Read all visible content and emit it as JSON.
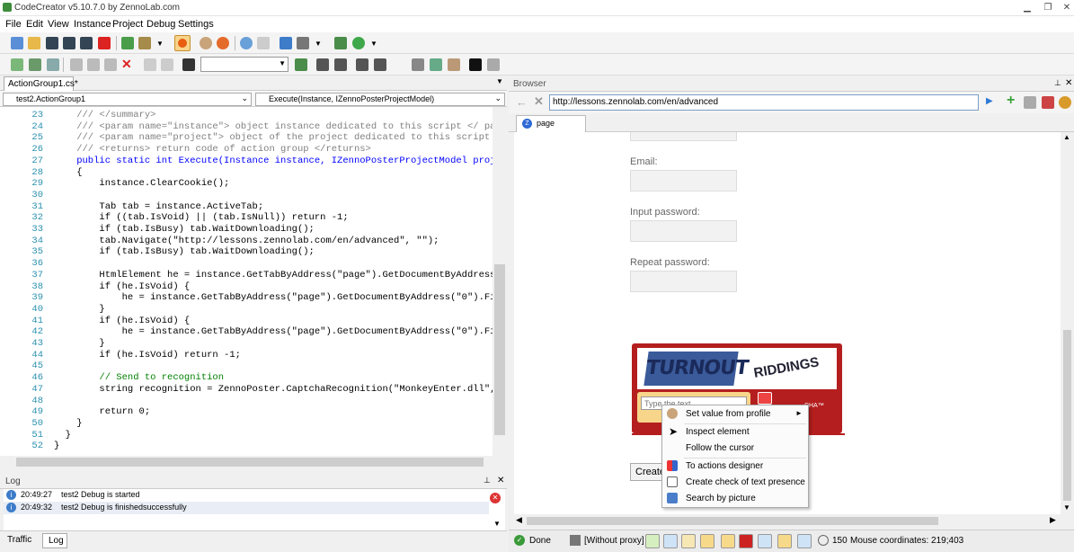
{
  "window": {
    "title": "CodeCreator v5.10.7.0 by ZennoLab.com"
  },
  "menu": [
    "File",
    "Edit",
    "View",
    "Instance",
    "Project",
    "Debug",
    "Settings"
  ],
  "editor": {
    "tab": "ActionGroup1.cs*",
    "class_combo": "test2.ActionGroup1",
    "method_combo": "Execute(Instance, IZennoPosterProjectModel)",
    "lines": [
      {
        "n": "23",
        "t": "    /// </summary>",
        "c": "xml"
      },
      {
        "n": "24",
        "t": "    /// <param name=\"instance\"> object instance dedicated to this script </ pa",
        "c": "xml"
      },
      {
        "n": "25",
        "t": "    /// <param name=\"project\"> object of the project dedicated to this script",
        "c": "xml"
      },
      {
        "n": "26",
        "t": "    /// <returns> return code of action group </returns>",
        "c": "xml"
      },
      {
        "n": "27",
        "t": "    public static int Execute(Instance instance, IZennoPosterProjectModel proj",
        "c": "kwline"
      },
      {
        "n": "28",
        "t": "    {",
        "c": ""
      },
      {
        "n": "29",
        "t": "        instance.ClearCookie();",
        "c": ""
      },
      {
        "n": "30",
        "t": "",
        "c": ""
      },
      {
        "n": "31",
        "t": "        Tab tab = instance.ActiveTab;",
        "c": ""
      },
      {
        "n": "32",
        "t": "        if ((tab.IsVoid) || (tab.IsNull)) return -1;",
        "c": ""
      },
      {
        "n": "33",
        "t": "        if (tab.IsBusy) tab.WaitDownloading();",
        "c": ""
      },
      {
        "n": "34",
        "t": "        tab.Navigate(\"http://lessons.zennolab.com/en/advanced\", \"\");",
        "c": ""
      },
      {
        "n": "35",
        "t": "        if (tab.IsBusy) tab.WaitDownloading();",
        "c": ""
      },
      {
        "n": "36",
        "t": "",
        "c": ""
      },
      {
        "n": "37",
        "t": "        HtmlElement he = instance.GetTabByAddress(\"page\").GetDocumentByAddress",
        "c": ""
      },
      {
        "n": "38",
        "t": "        if (he.IsVoid) {",
        "c": ""
      },
      {
        "n": "39",
        "t": "            he = instance.GetTabByAddress(\"page\").GetDocumentByAddress(\"0\").Fi",
        "c": ""
      },
      {
        "n": "40",
        "t": "        }",
        "c": ""
      },
      {
        "n": "41",
        "t": "        if (he.IsVoid) {",
        "c": ""
      },
      {
        "n": "42",
        "t": "            he = instance.GetTabByAddress(\"page\").GetDocumentByAddress(\"0\").Fi",
        "c": ""
      },
      {
        "n": "43",
        "t": "        }",
        "c": ""
      },
      {
        "n": "44",
        "t": "        if (he.IsVoid) return -1;",
        "c": ""
      },
      {
        "n": "45",
        "t": "",
        "c": ""
      },
      {
        "n": "46",
        "t": "        // Send to recognition",
        "c": "cm"
      },
      {
        "n": "47",
        "t": "        string recognition = ZennoPoster.CaptchaRecognition(\"MonkeyEnter.dll\",",
        "c": ""
      },
      {
        "n": "48",
        "t": "",
        "c": ""
      },
      {
        "n": "49",
        "t": "        return 0;",
        "c": ""
      },
      {
        "n": "50",
        "t": "    }",
        "c": ""
      },
      {
        "n": "51",
        "t": "  }",
        "c": ""
      },
      {
        "n": "52",
        "t": "}",
        "c": ""
      }
    ]
  },
  "log": {
    "title": "Log",
    "entries": [
      {
        "time": "20:49:27",
        "msg": "test2 Debug is started"
      },
      {
        "time": "20:49:32",
        "msg": "test2 Debug is finishedsuccessfully"
      }
    ],
    "tabs": [
      "Traffic",
      "Log"
    ]
  },
  "browser": {
    "title": "Browser",
    "url": "http://lessons.zennolab.com/en/advanced",
    "tab": "page",
    "labels": {
      "email": "Email:",
      "password": "Input password:",
      "repeat": "Repeat password:"
    },
    "captcha": {
      "word1": "TURNOUT",
      "word2": "RIDDINGS",
      "placeholder": "Type the text",
      "brand": "CHA™"
    },
    "create_button": "Create"
  },
  "context_menu": [
    {
      "label": "Set value from profile",
      "icon": "profile-icon",
      "arrow": "►"
    },
    {
      "label": "Inspect element",
      "icon": "cursor-icon"
    },
    {
      "label": "Follow the cursor",
      "icon": ""
    },
    {
      "label": "To actions designer",
      "icon": "designer-icon"
    },
    {
      "label": "Create check of text presence",
      "icon": "text-check-icon"
    },
    {
      "label": "Search by picture",
      "icon": "picture-search-icon"
    }
  ],
  "status": {
    "done": "Done",
    "proxy": "[Without proxy]",
    "zoom": "150",
    "mouse": "Mouse coordinates: 219;403"
  }
}
